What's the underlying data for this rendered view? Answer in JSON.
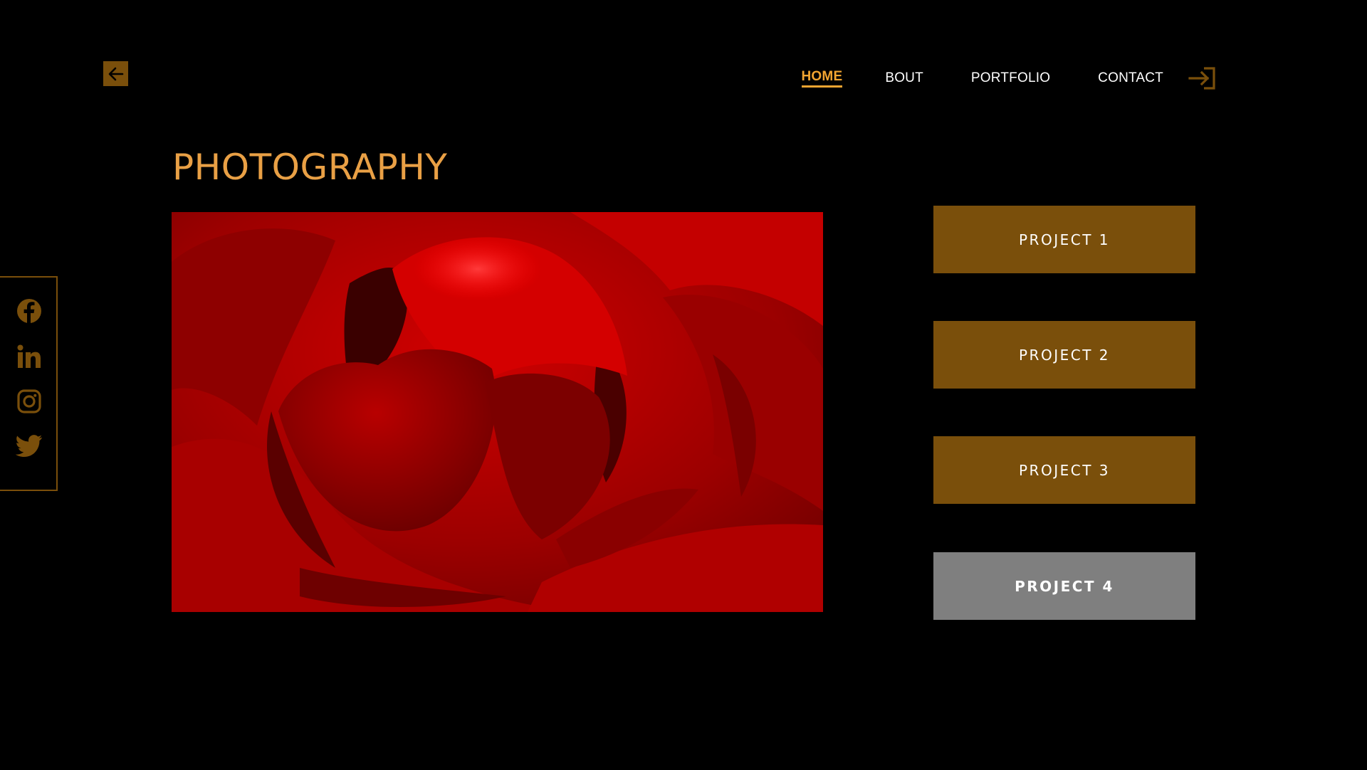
{
  "nav": {
    "items": [
      {
        "label": "HOME",
        "active": true
      },
      {
        "label": "BOUT",
        "active": false
      },
      {
        "label": "PORTFOLIO",
        "active": false
      },
      {
        "label": "CONTACT",
        "active": false
      }
    ],
    "back_icon": "arrow-left-icon",
    "login_icon": "sign-in-icon"
  },
  "main": {
    "title": "PHOTOGRAPHY",
    "photo_subject": "red-rose-closeup"
  },
  "projects": [
    {
      "label": "PROJECT 1",
      "selected": false
    },
    {
      "label": "PROJECT 2",
      "selected": false
    },
    {
      "label": "PROJECT 3",
      "selected": false
    },
    {
      "label": "PROJECT 4",
      "selected": true
    }
  ],
  "social": {
    "icons": [
      "facebook-icon",
      "linkedin-icon",
      "instagram-icon",
      "twitter-icon"
    ]
  },
  "colors": {
    "accent": "#f2a531",
    "title": "#e9a045",
    "brown": "#7a4f0b",
    "selected_gray": "#7f7f7f",
    "background": "#000000"
  }
}
